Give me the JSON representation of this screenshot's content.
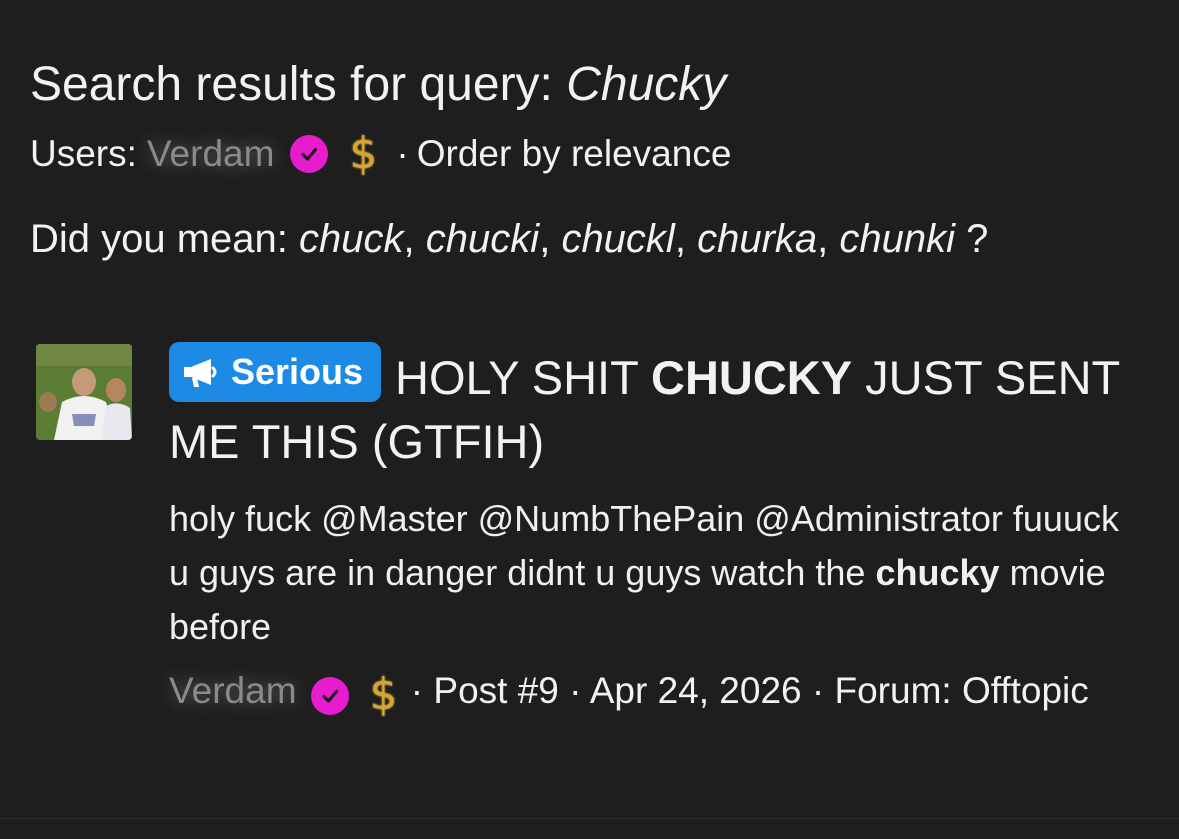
{
  "search": {
    "heading_prefix": "Search results for query:",
    "query": "Chucky"
  },
  "users_line": {
    "label": "Users:",
    "username": "Verdam",
    "separator": "·",
    "order_label": "Order by relevance"
  },
  "did_you_mean": {
    "label": "Did you mean:",
    "suggestions": [
      "chuck",
      "chucki",
      "chuckl",
      "churka",
      "chunki"
    ],
    "comma": ",",
    "question": "?"
  },
  "result": {
    "prefix_label": "Serious",
    "title_before": "HOLY SHIT",
    "title_highlight": "CHUCKY",
    "title_after": "JUST SENT ME THIS (GTFIH)",
    "snippet_before": "holy fuck @Master @NumbThePain @Administrator fuuuck u guys are in danger didnt u guys watch the",
    "snippet_highlight": "chucky",
    "snippet_after": "movie before",
    "author": "Verdam",
    "post_label": "· Post #9",
    "date": "· Apr 24, 2026",
    "forum_label": "· Forum:",
    "forum": "Offtopic"
  },
  "colors": {
    "background": "#1e1e1f",
    "text": "#f2f2f2",
    "muted_username": "#8a8a8a",
    "verified_badge": "#e81ccf",
    "prefix_badge": "#1d8ae6",
    "dollar_badge": "#d9a52b"
  },
  "icons": {
    "verified": "check-circle-icon",
    "premium": "dollar-icon",
    "prefix": "megaphone-icon"
  }
}
